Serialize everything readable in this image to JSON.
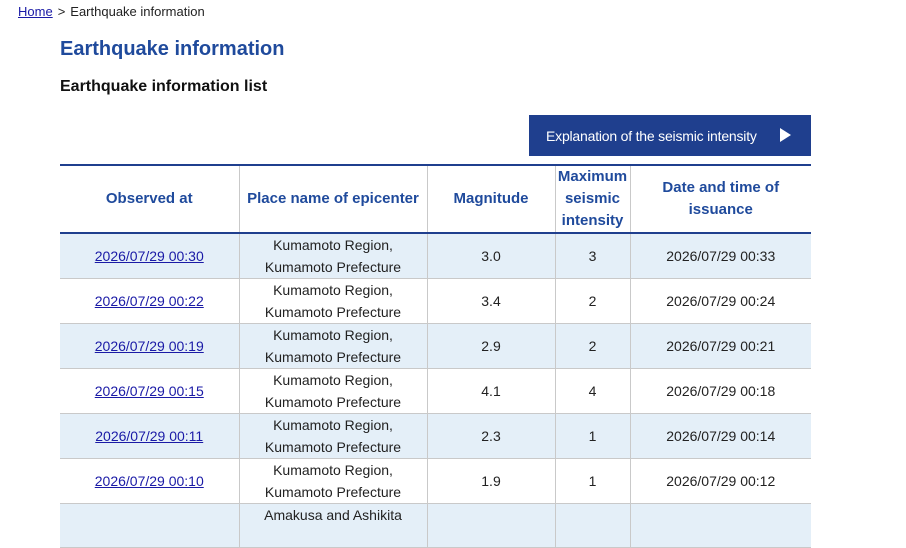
{
  "breadcrumb": {
    "home_label": "Home",
    "separator": ">",
    "current": "Earthquake information"
  },
  "page": {
    "title": "Earthquake information",
    "section_title": "Earthquake information list"
  },
  "intensity_button": {
    "label": "Explanation of the seismic intensity",
    "icon": "play-arrow-icon"
  },
  "colors": {
    "accent": "#1f3f8e",
    "heading": "#1f4a9c",
    "link": "#1a1aa6",
    "row_alt": "#e4eff8"
  },
  "table": {
    "headers": {
      "observed_at": "Observed at",
      "epicenter": "Place name of epicenter",
      "magnitude": "Magnitude",
      "max_intensity": "Maximum seismic intensity",
      "issuance": "Date and time of issuance"
    },
    "rows": [
      {
        "observed": "2026/07/29 00:30",
        "place_line1": "Kumamoto Region,",
        "place_line2": "Kumamoto Prefecture",
        "magnitude": "3.0",
        "intensity": "3",
        "issued": "2026/07/29 00:33"
      },
      {
        "observed": "2026/07/29 00:22",
        "place_line1": "Kumamoto Region,",
        "place_line2": "Kumamoto Prefecture",
        "magnitude": "3.4",
        "intensity": "2",
        "issued": "2026/07/29 00:24"
      },
      {
        "observed": "2026/07/29 00:19",
        "place_line1": "Kumamoto Region,",
        "place_line2": "Kumamoto Prefecture",
        "magnitude": "2.9",
        "intensity": "2",
        "issued": "2026/07/29 00:21"
      },
      {
        "observed": "2026/07/29 00:15",
        "place_line1": "Kumamoto Region,",
        "place_line2": "Kumamoto Prefecture",
        "magnitude": "4.1",
        "intensity": "4",
        "issued": "2026/07/29 00:18"
      },
      {
        "observed": "2026/07/29 00:11",
        "place_line1": "Kumamoto Region,",
        "place_line2": "Kumamoto Prefecture",
        "magnitude": "2.3",
        "intensity": "1",
        "issued": "2026/07/29 00:14"
      },
      {
        "observed": "2026/07/29 00:10",
        "place_line1": "Kumamoto Region,",
        "place_line2": "Kumamoto Prefecture",
        "magnitude": "1.9",
        "intensity": "1",
        "issued": "2026/07/29 00:12"
      },
      {
        "observed": "",
        "place_line1": "Amakusa and Ashikita",
        "place_line2": "",
        "magnitude": "",
        "intensity": "",
        "issued": ""
      }
    ]
  }
}
